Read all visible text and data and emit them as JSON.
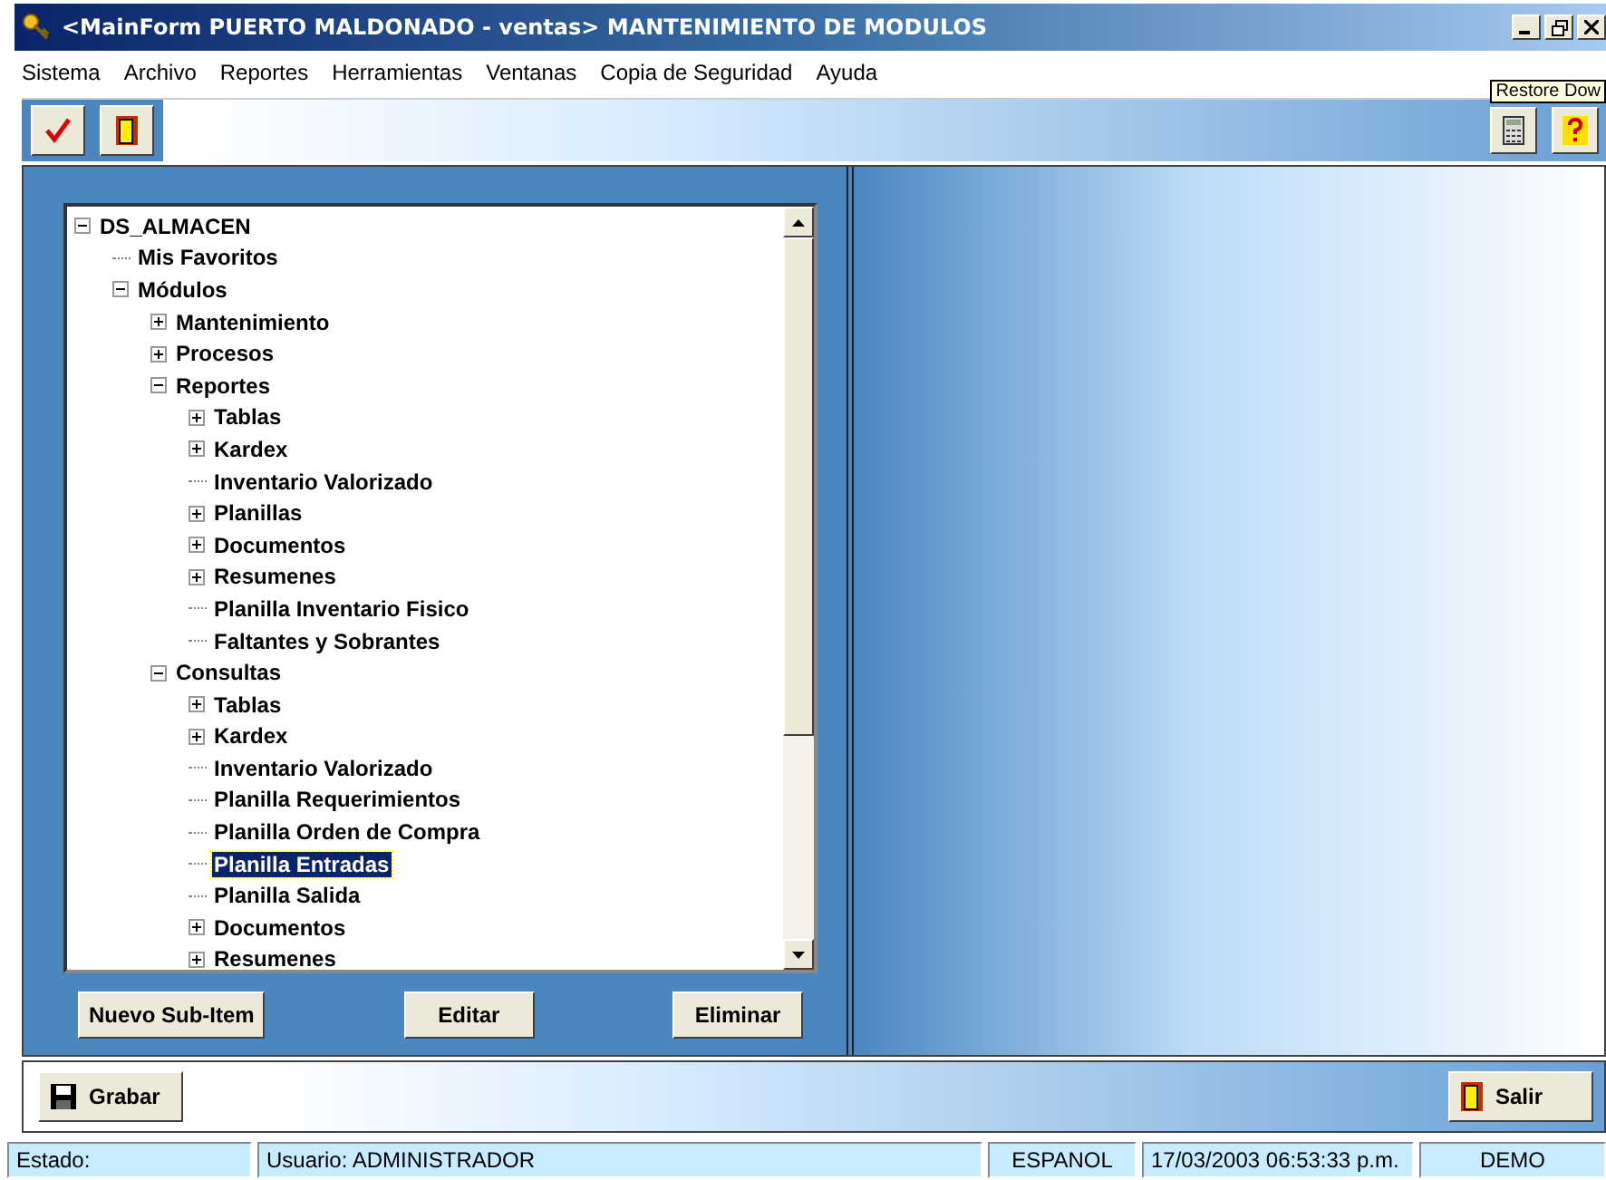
{
  "window": {
    "title": "<MainForm PUERTO MALDONADO - ventas> MANTENIMIENTO DE MODULOS",
    "tooltip": "Restore Dow"
  },
  "menu": [
    "Sistema",
    "Archivo",
    "Reportes",
    "Herramientas",
    "Ventanas",
    "Copia de Seguridad",
    "Ayuda"
  ],
  "tree": [
    {
      "label": "DS_ALMACEN",
      "expanded": true,
      "selected": false,
      "children": [
        {
          "label": "Mis Favoritos",
          "selected": false
        },
        {
          "label": "Módulos",
          "expanded": true,
          "selected": false,
          "children": [
            {
              "label": "Mantenimiento",
              "expanded": false,
              "selected": false
            },
            {
              "label": "Procesos",
              "expanded": false,
              "selected": false
            },
            {
              "label": "Reportes",
              "expanded": true,
              "selected": false,
              "children": [
                {
                  "label": "Tablas",
                  "expanded": false,
                  "selected": false
                },
                {
                  "label": "Kardex",
                  "expanded": false,
                  "selected": false
                },
                {
                  "label": "Inventario Valorizado",
                  "selected": false
                },
                {
                  "label": "Planillas",
                  "expanded": false,
                  "selected": false
                },
                {
                  "label": "Documentos",
                  "expanded": false,
                  "selected": false
                },
                {
                  "label": "Resumenes",
                  "expanded": false,
                  "selected": false
                },
                {
                  "label": "Planilla Inventario Fisico",
                  "selected": false
                },
                {
                  "label": "Faltantes y Sobrantes",
                  "selected": false
                }
              ]
            },
            {
              "label": "Consultas",
              "expanded": true,
              "selected": false,
              "children": [
                {
                  "label": "Tablas",
                  "expanded": false,
                  "selected": false
                },
                {
                  "label": "Kardex",
                  "expanded": false,
                  "selected": false
                },
                {
                  "label": "Inventario Valorizado",
                  "selected": false
                },
                {
                  "label": "Planilla Requerimientos",
                  "selected": false
                },
                {
                  "label": "Planilla Orden de Compra",
                  "selected": false
                },
                {
                  "label": "Planilla Entradas",
                  "selected": true
                },
                {
                  "label": "Planilla Salida",
                  "selected": false
                },
                {
                  "label": "Documentos",
                  "expanded": false,
                  "selected": false
                },
                {
                  "label": "Resumenes",
                  "expanded": false,
                  "selected": false
                }
              ]
            }
          ]
        }
      ]
    }
  ],
  "tree_buttons": [
    "Nuevo Sub-Item",
    "Editar",
    "Eliminar"
  ],
  "bottom_buttons": [
    {
      "label": "Grabar",
      "kind": "save"
    },
    {
      "label": "Salir",
      "kind": "exit"
    }
  ],
  "status_bar": [
    "Estado:",
    "Usuario: ADMINISTRADOR",
    "ESPANOL",
    "17/03/2003 06:53:33 p.m.",
    "DEMO"
  ]
}
